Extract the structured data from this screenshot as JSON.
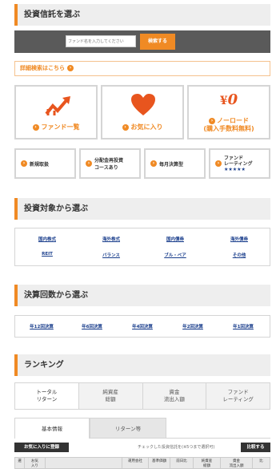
{
  "sections": {
    "select_fund": "投資信託を選ぶ",
    "by_target": "投資対象から選ぶ",
    "by_settlement": "決算回数から選ぶ",
    "ranking": "ランキング"
  },
  "search": {
    "placeholder": "ファンド名を入力してください",
    "button": "検索する"
  },
  "advanced_search": "詳細検索はこちら",
  "big_cards": [
    {
      "label": "ファンド一覧"
    },
    {
      "label": "お気に入り"
    },
    {
      "label": "ノーロード",
      "label2": "(購入手数料無料)"
    }
  ],
  "small_cards": [
    {
      "label": "新規取扱"
    },
    {
      "label": "分配金再投資",
      "label2": "コースあり"
    },
    {
      "label": "毎月決算型"
    },
    {
      "label": "ファンド",
      "label2": "レーティング",
      "stars": "★★★★★"
    }
  ],
  "target_links": [
    "国内株式",
    "海外株式",
    "国内債券",
    "海外債券",
    "REIT",
    "バランス",
    "ブル・ベア",
    "その他"
  ],
  "settlement_links": [
    "年12回決算",
    "年6回決算",
    "年4回決算",
    "年2回決算",
    "年1回決算"
  ],
  "ranking_tabs": [
    {
      "l1": "トータル",
      "l2": "リターン"
    },
    {
      "l1": "純資産",
      "l2": "総額"
    },
    {
      "l1": "資金",
      "l2": "流出入額"
    },
    {
      "l1": "ファンド",
      "l2": "レーティング"
    }
  ],
  "sub_tabs": [
    "基本情報",
    "リターン等"
  ],
  "favorites_button": "お気に入りに登録",
  "compare_note": "チェックした投資信託を(※5つまで選択可)",
  "compare_button": "比較する",
  "table_headers": [
    "選",
    "お気\n入り",
    "",
    "運用会社",
    "基準価額",
    "前日比",
    "純資産\n総額",
    "資金\n流出入額",
    "比"
  ],
  "colors": {
    "accent": "#f08a24",
    "link": "#1a3e8c",
    "heart": "#e8551e"
  }
}
